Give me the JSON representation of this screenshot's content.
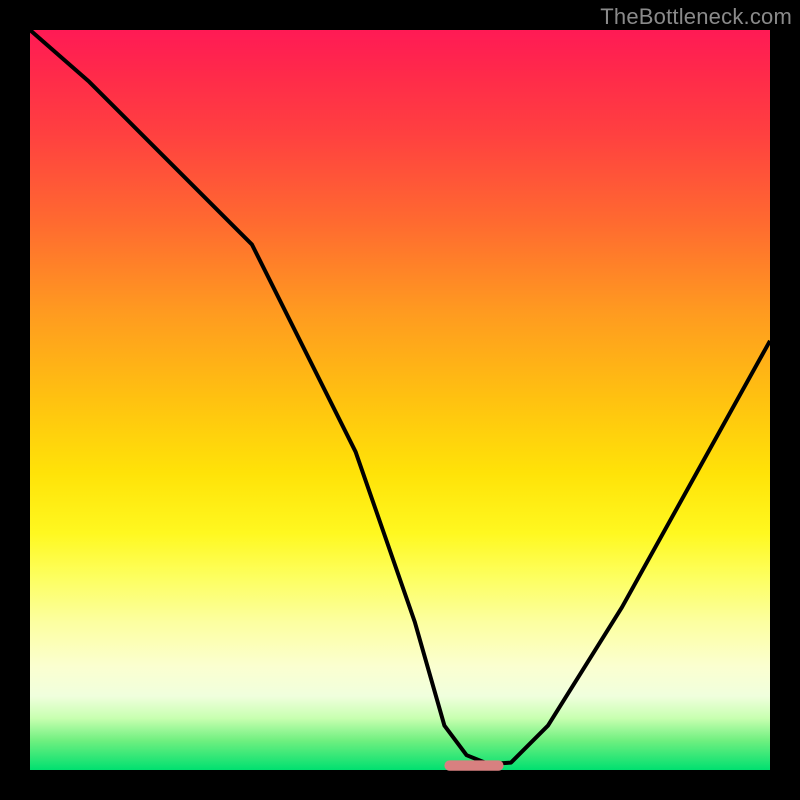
{
  "watermark": "TheBottleneck.com",
  "chart_data": {
    "type": "line",
    "title": "",
    "xlabel": "",
    "ylabel": "",
    "xlim": [
      0,
      100
    ],
    "ylim": [
      0,
      100
    ],
    "grid": false,
    "series": [
      {
        "name": "bottleneck-curve",
        "x": [
          0,
          8,
          18,
          28,
          30,
          44,
          52,
          56,
          59,
          62,
          65,
          70,
          80,
          90,
          100
        ],
        "values": [
          100,
          93,
          83,
          73,
          71,
          43,
          20,
          6,
          2,
          0.8,
          1,
          6,
          22,
          40,
          58
        ],
        "color": "#000000",
        "stroke_width": 4
      }
    ],
    "markers": [
      {
        "name": "optimal-marker",
        "x_start": 56,
        "x_end": 64,
        "y": 0.6,
        "color": "#d88080",
        "thickness_pct": 1.4
      }
    ]
  }
}
